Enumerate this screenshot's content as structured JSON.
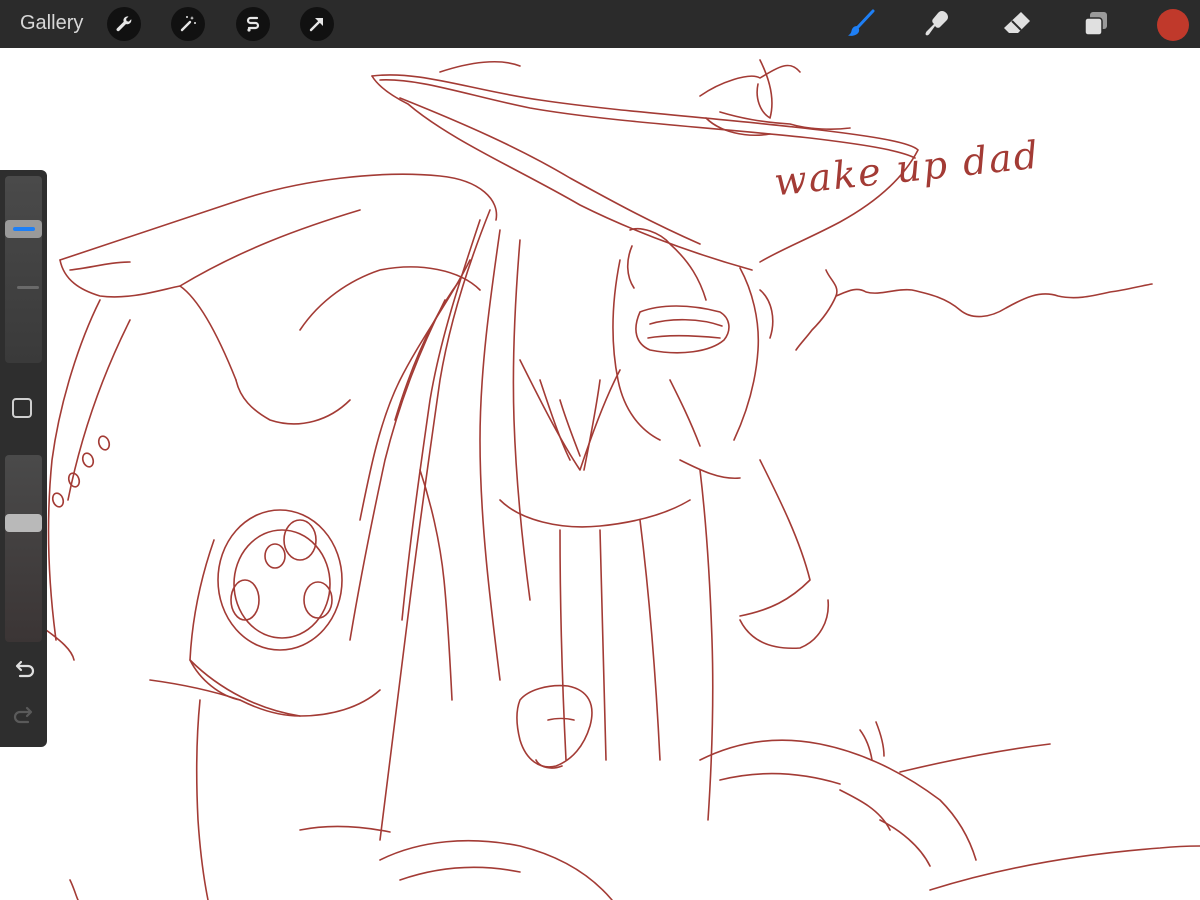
{
  "toolbar": {
    "gallery_label": "Gallery",
    "action_icons": [
      "wrench-icon",
      "magic-wand-icon",
      "selection-icon",
      "transform-arrow-icon"
    ],
    "tool_icons": [
      "brush-icon",
      "smudge-icon",
      "eraser-icon",
      "layers-icon"
    ],
    "active_tool": "brush",
    "accent_color": "#1e7ff5",
    "current_color": "#c0392b"
  },
  "sidebar": {
    "brush_size": 0.74,
    "opacity": 0.65
  },
  "canvas": {
    "caption": "wake up dad",
    "stroke_color": "#a33b35",
    "background_color": "#ffffff"
  }
}
